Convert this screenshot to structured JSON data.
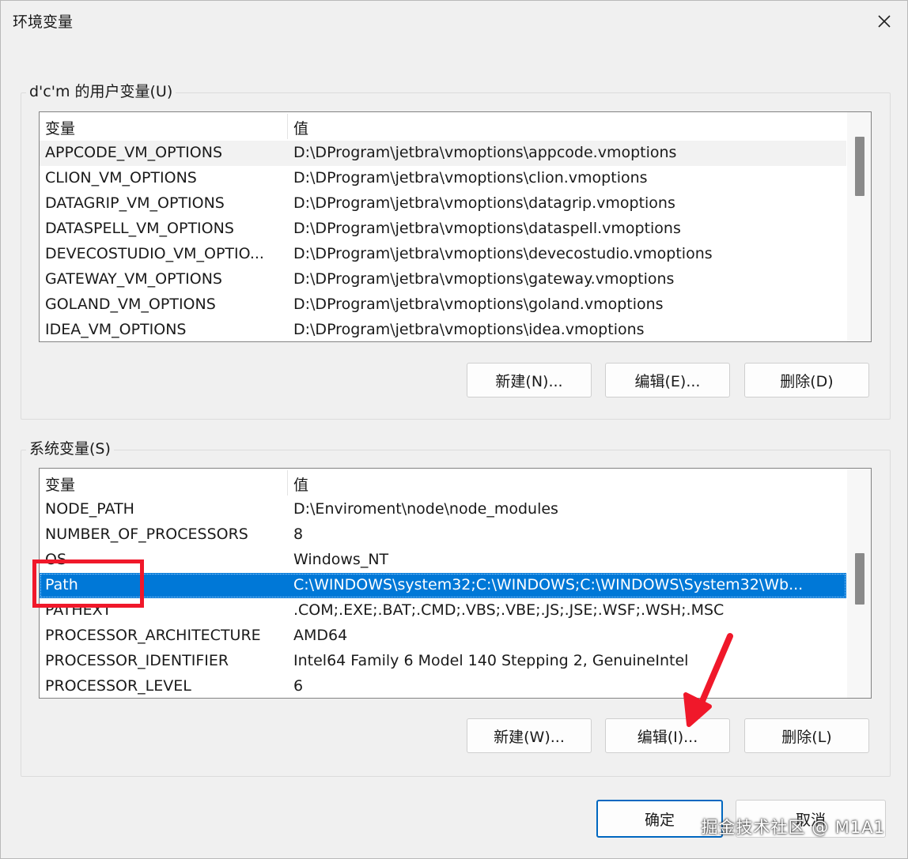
{
  "window": {
    "title": "环境变量",
    "close_icon": "close-icon"
  },
  "user_vars": {
    "label": "d'c'm 的用户变量(U)",
    "columns": [
      "变量",
      "值"
    ],
    "rows": [
      {
        "name": "APPCODE_VM_OPTIONS",
        "value": "D:\\DProgram\\jetbra\\vmoptions\\appcode.vmoptions"
      },
      {
        "name": "CLION_VM_OPTIONS",
        "value": "D:\\DProgram\\jetbra\\vmoptions\\clion.vmoptions"
      },
      {
        "name": "DATAGRIP_VM_OPTIONS",
        "value": "D:\\DProgram\\jetbra\\vmoptions\\datagrip.vmoptions"
      },
      {
        "name": "DATASPELL_VM_OPTIONS",
        "value": "D:\\DProgram\\jetbra\\vmoptions\\dataspell.vmoptions"
      },
      {
        "name": "DEVECOSTUDIO_VM_OPTIO...",
        "value": "D:\\DProgram\\jetbra\\vmoptions\\devecostudio.vmoptions"
      },
      {
        "name": "GATEWAY_VM_OPTIONS",
        "value": "D:\\DProgram\\jetbra\\vmoptions\\gateway.vmoptions"
      },
      {
        "name": "GOLAND_VM_OPTIONS",
        "value": "D:\\DProgram\\jetbra\\vmoptions\\goland.vmoptions"
      },
      {
        "name": "IDEA_VM_OPTIONS",
        "value": "D:\\DProgram\\jetbra\\vmoptions\\idea.vmoptions"
      }
    ],
    "buttons": {
      "new": "新建(N)...",
      "edit": "编辑(E)...",
      "delete": "删除(D)"
    }
  },
  "system_vars": {
    "label": "系统变量(S)",
    "columns": [
      "变量",
      "值"
    ],
    "rows": [
      {
        "name": "NODE_PATH",
        "value": "D:\\Enviroment\\node\\node_modules"
      },
      {
        "name": "NUMBER_OF_PROCESSORS",
        "value": "8"
      },
      {
        "name": "OS",
        "value": "Windows_NT"
      },
      {
        "name": "Path",
        "value": "C:\\WINDOWS\\system32;C:\\WINDOWS;C:\\WINDOWS\\System32\\Wb..."
      },
      {
        "name": "PATHEXT",
        "value": ".COM;.EXE;.BAT;.CMD;.VBS;.VBE;.JS;.JSE;.WSF;.WSH;.MSC"
      },
      {
        "name": "PROCESSOR_ARCHITECTURE",
        "value": "AMD64"
      },
      {
        "name": "PROCESSOR_IDENTIFIER",
        "value": "Intel64 Family 6 Model 140 Stepping 2, GenuineIntel"
      },
      {
        "name": "PROCESSOR_LEVEL",
        "value": "6"
      }
    ],
    "selected_row": "Path",
    "buttons": {
      "new": "新建(W)...",
      "edit": "编辑(I)...",
      "delete": "删除(L)"
    }
  },
  "footer": {
    "ok": "确定",
    "cancel": "取消"
  },
  "watermark": "掘金技术社区 @ M1A1",
  "colors": {
    "selection": "#0078d7",
    "annotation": "#f0182a",
    "primary_border": "#0067c0"
  }
}
